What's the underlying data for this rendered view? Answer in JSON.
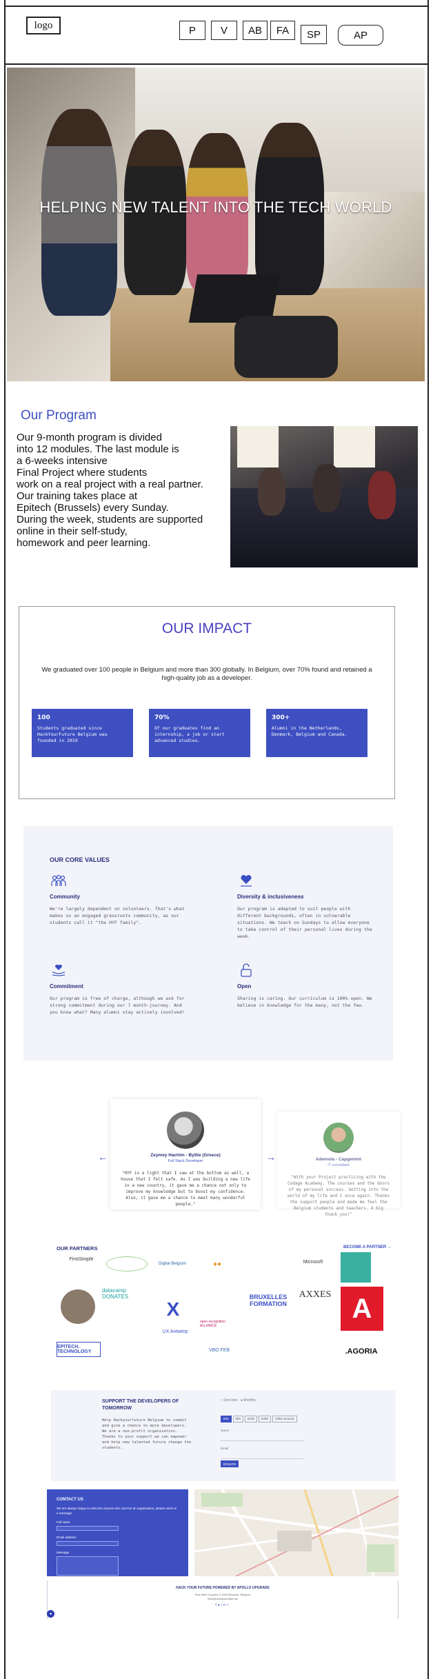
{
  "header": {
    "logo": "logo",
    "nav": [
      "P",
      "V",
      "AB",
      "FA",
      "SP"
    ],
    "account": "AP"
  },
  "hero": {
    "title": "HELPING NEW TALENT INTO THE TECH WORLD"
  },
  "program": {
    "title": "Our Program",
    "text": "Our 9-month program is divided\ninto 12 modules. The last module is\na 6-weeks intensive\n Final Project where students\nwork on a real project with a real partner.\nOur training takes place at\n Epitech (Brussels) every Sunday.\nDuring the week, students are supported\nonline in their self-study,\n homework and peer learning."
  },
  "impact": {
    "title": "OUR IMPACT",
    "text": "We graduated over 100 people in Belgium and more than 300 globally. In Belgium, over 70% found and retained a high-quality job as a developer.",
    "cards": [
      {
        "number": "100",
        "text": "Students graduated since HackYourFuture Belgium was founded in 2019"
      },
      {
        "number": "70%",
        "text": "Of our graduates find an internship, a job or start advanced studies."
      },
      {
        "number": "300+",
        "text": "Alumni in the Netherlands, Denmark, Belgium and Canada."
      }
    ]
  },
  "values": {
    "title": "OUR CORE VALUES",
    "items": [
      {
        "icon": "community-icon",
        "title": "Community",
        "text": "We're largely dependent on volunteers. That's what makes us an engaged grassroots community, as our students call it \"the HYF family\"."
      },
      {
        "icon": "heart-hand-icon",
        "title": "Diversity & inclusiveness",
        "text": "Our program is adapted to suit people with different backgrounds, often in vulnerable situations. We teach on Sundays to allow everyone to take control of their personal lives during the week."
      },
      {
        "icon": "commitment-icon",
        "title": "Commitment",
        "text": "Our program is free of charge, although we ask for strong commitment during our 7 month-journey. And you know what? Many alumni stay actively involved!"
      },
      {
        "icon": "lock-open-icon",
        "title": "Open",
        "text": "Sharing is caring. Our curriculum is 100% open. We believe in knowledge for the many, not the few."
      }
    ]
  },
  "testimonials": {
    "main": {
      "name": "Zeymey Hachim - Byttie (Greece)",
      "role": "Full Stack Developer",
      "quote": "\"HYF is a light that I saw at the bottom as well, a house that I felt safe. As I was building a new life in a new country, it gave me a chance not only to improve my knowledge but to boost my confidence. Also, it gave me a chance to meet many wonderful people.\""
    },
    "side": {
      "name": "Ademola - Capgemini",
      "role": "IT consultant",
      "quote": "\"With your Project practicing with the Codage Academy. The courses and the doors of my personal success. Getting into the world of my life and I once again. Thanks the support people and made me feel the Belgium students and teachers. A big thank you!\""
    }
  },
  "partners": {
    "title": "OUR PARTNERS",
    "become": "BECOME A PARTNER →",
    "logos": [
      "FirstSimple",
      "Digital Belgium",
      "Microsoft",
      "datacamp DONATES",
      "BRUXELLES FORMATION",
      "AXXES",
      "UX Antwerp",
      "open recognition ALLIANCE",
      "EPITECH. TECHNOLOGY",
      "VBO FEB",
      ".AGORIA"
    ]
  },
  "support": {
    "title": "SUPPORT THE DEVELOPERS OF TOMORROW",
    "text": "Help Hackyourfuture Belgium to commit and give a chance to more developers. We are a non-profit organization. Thanks to your support we can empower and help new talented future change the students.",
    "radio": [
      "One time",
      "Monthly"
    ],
    "amounts": [
      "€20",
      "€50",
      "€100",
      "€250",
      "Other amount"
    ],
    "fields": [
      "Name",
      "Email"
    ],
    "submit": "DONATE"
  },
  "contact": {
    "title": "CONTACT US",
    "text": "We are always happy to welcome anyone who can't be an organisation, please send us a message.",
    "fields": [
      "Full name",
      "Email address",
      "Message"
    ]
  },
  "footer": {
    "title": "HACK YOUR FUTURE POWERED BY APOLLO UPGRADE",
    "address": "Rue Abbé Cuypers 3 1040 Brussels, Belgium",
    "email": "hello@hackyourfuture.be"
  },
  "colors": {
    "accent": "#3d4fc1",
    "title_blue": "#3b4fc4",
    "navy": "#2b2f7a",
    "panel": "#f3f4fa"
  }
}
